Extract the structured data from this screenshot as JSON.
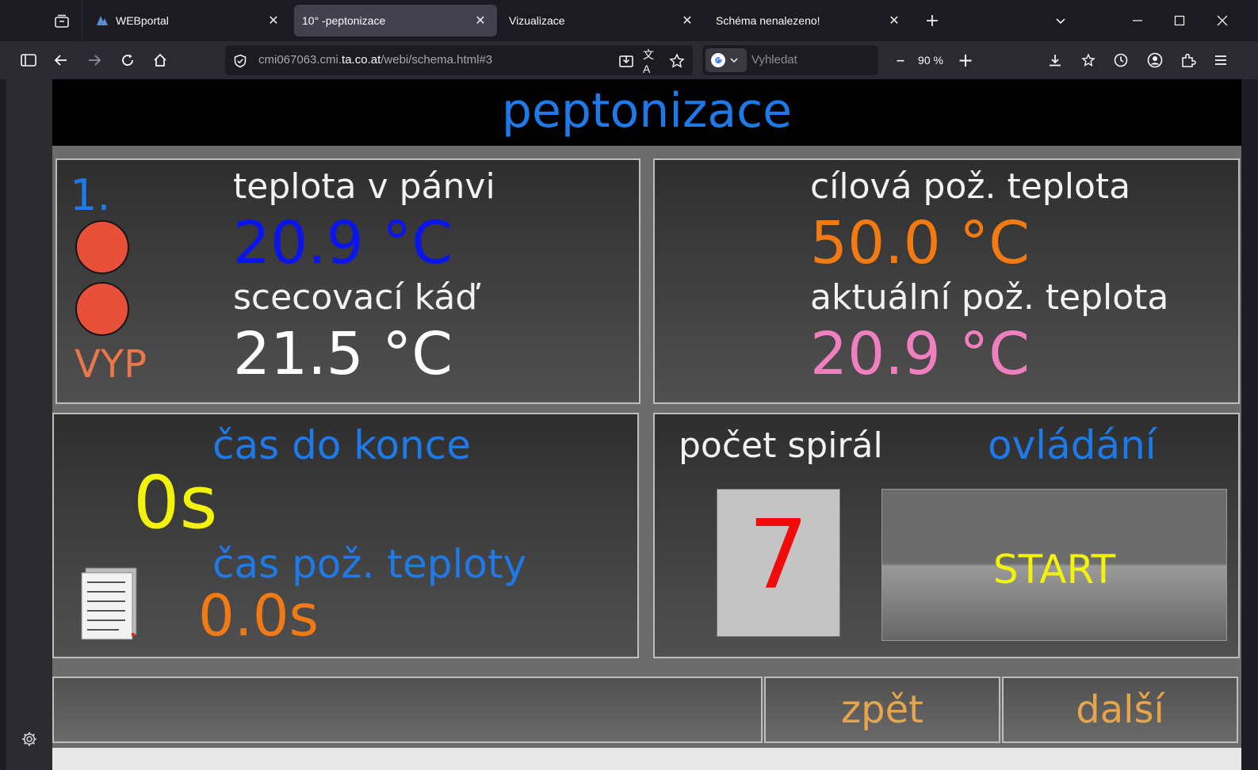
{
  "browser": {
    "tabs": [
      {
        "label": "WEBportal",
        "active": false
      },
      {
        "label": "10° -peptonizace",
        "active": true
      },
      {
        "label": "Vizualizace",
        "active": false
      },
      {
        "label": "Schéma nenalezeno!",
        "active": false
      }
    ],
    "url_prefix": "cmi067063.cmi.",
    "url_domain": "ta.co.at",
    "url_suffix": "/webi/schema.html#3",
    "search_placeholder": "Vyhledat",
    "zoom_level": "90 %"
  },
  "page": {
    "title": "peptonizace",
    "step_number": "1.",
    "status": "VYP",
    "pan_temp_label": "teplota v pánvi",
    "pan_temp_value": "20.9 °C",
    "tub_label": "scecovací káď",
    "tub_value": "21.5 °C",
    "target_temp_label": "cílová pož. teplota",
    "target_temp_value": "50.0 °C",
    "current_temp_label": "aktuální pož. teplota",
    "current_temp_value": "20.9 °C",
    "time_left_label": "čas do konce",
    "time_left_value": "0s",
    "temp_time_label": "čas pož. teploty",
    "temp_time_value": "0.0s",
    "spiral_label": "počet spirál",
    "spiral_value": "7",
    "control_label": "ovládání",
    "start_label": "START",
    "back_label": "zpět",
    "next_label": "další"
  },
  "colors": {
    "title_blue": "#1d7ae8",
    "pan_temp_blue": "#0a14ee",
    "target_orange": "#f27a12",
    "current_pink": "#ef7fbe",
    "time_yellow": "#f2f20c",
    "spiral_red": "#f20b0b",
    "lamp_red": "#e8503a",
    "nav_button_text": "#e6a54a"
  }
}
